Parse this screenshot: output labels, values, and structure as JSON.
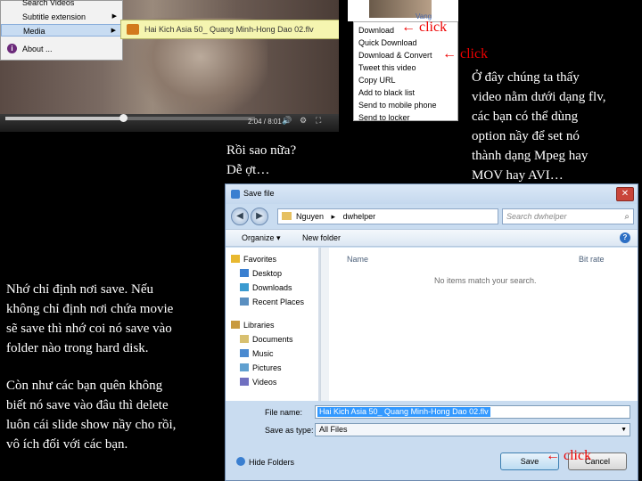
{
  "context_menu": {
    "items": [
      {
        "label": "Search Videos"
      },
      {
        "label": "Subtitle extension"
      },
      {
        "label": "Media"
      },
      {
        "label": "About ..."
      }
    ]
  },
  "file_pill": {
    "filename": "Hai Kich Asia 50_ Quang Minh-Hong Dao 02.flv"
  },
  "player": {
    "time": "2:04 / 8:01",
    "progress": 0.47
  },
  "thumb_link": "Vang",
  "download_menu": {
    "items": [
      "Download",
      "Quick Download",
      "Download & Convert",
      "Tweet this video",
      "Copy URL",
      "Add to black list",
      "Send to mobile phone",
      "Send to locker"
    ]
  },
  "annotations": {
    "click_label": "click",
    "arrow": "←",
    "right_note": [
      "Ở đây chúng ta thấy",
      "video nằm dưới dạng flv,",
      "các bạn có thể dùng",
      "option nầy để set nó",
      "thành dạng Mpeg hay",
      "MOV hay AVI…"
    ],
    "middle_note": [
      "Rồi sao nữa?",
      "Dễ ợt…"
    ],
    "left_note_1": [
      "Nhớ chỉ định nơi save. Nếu",
      "không chỉ định nơi chứa movie",
      "sẽ save thì nhớ coi nó save vào",
      "folder nào trong hard disk."
    ],
    "left_note_2": [
      "Còn như các bạn quên không",
      "biết nó save vào đâu thì delete",
      "luôn cái slide show nầy cho rồi,",
      "vô ích đối với các bạn."
    ]
  },
  "dialog": {
    "title": "Save file",
    "path": [
      "Nguyen",
      "dwhelper"
    ],
    "search_placeholder": "Search dwhelper",
    "toolbar": {
      "organize": "Organize ▾",
      "new_folder": "New folder"
    },
    "nav": [
      {
        "label": "Favorites",
        "header": true,
        "icon": "star-icon"
      },
      {
        "label": "Desktop",
        "icon": "desktop-icon"
      },
      {
        "label": "Downloads",
        "icon": "downloads-icon"
      },
      {
        "label": "Recent Places",
        "icon": "recent-places-icon"
      },
      {
        "label": "Libraries",
        "header": true,
        "icon": "libraries-icon"
      },
      {
        "label": "Documents",
        "icon": "documents-icon"
      },
      {
        "label": "Music",
        "icon": "music-icon"
      },
      {
        "label": "Pictures",
        "icon": "pictures-icon"
      },
      {
        "label": "Videos",
        "icon": "videos-icon"
      }
    ],
    "columns": {
      "name": "Name",
      "bitrate": "Bit rate"
    },
    "empty_text": "No items match your search.",
    "file_name_label": "File name:",
    "file_name_value": "Hai Kich Asia 50_ Quang Minh-Hong Dao 02.flv",
    "save_type_label": "Save as type:",
    "save_type_value": "All Files",
    "hide_folders": "Hide Folders",
    "save_button": "Save",
    "cancel_button": "Cancel"
  },
  "colors": {
    "click": "#e00000",
    "dialog_bg": "#c9dcf0",
    "pill_bg": "#f5f5b0"
  }
}
